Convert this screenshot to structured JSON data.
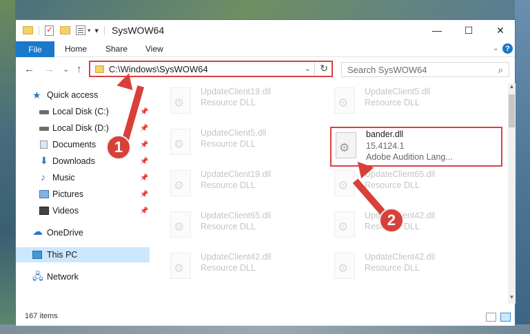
{
  "titlebar": {
    "title": "SysWOW64",
    "minimize": "—",
    "maximize": "☐",
    "close": "✕"
  },
  "ribbon": {
    "tabs": [
      "File",
      "Home",
      "Share",
      "View"
    ],
    "expand_glyph": "⌄",
    "help_glyph": "?"
  },
  "address": {
    "back": "←",
    "forward": "→",
    "recent": "⌄",
    "up": "↑",
    "path": "C:\\Windows\\SysWOW64",
    "dropdown": "⌄",
    "refresh": "↻"
  },
  "search": {
    "placeholder": "Search SysWOW64",
    "icon": "⌕"
  },
  "nav": {
    "items": [
      {
        "label": "Quick access",
        "icon": "star-icon",
        "pinned": false
      },
      {
        "label": "Local Disk (C:)",
        "icon": "drive-icon",
        "pinned": true
      },
      {
        "label": "Local Disk (D:)",
        "icon": "drive-icon",
        "pinned": true
      },
      {
        "label": "Documents",
        "icon": "documents-icon",
        "pinned": true
      },
      {
        "label": "Downloads",
        "icon": "downloads-icon",
        "pinned": true
      },
      {
        "label": "Music",
        "icon": "music-icon",
        "pinned": true
      },
      {
        "label": "Pictures",
        "icon": "pictures-icon",
        "pinned": true
      },
      {
        "label": "Videos",
        "icon": "videos-icon",
        "pinned": true
      },
      {
        "label": "OneDrive",
        "icon": "cloud-icon",
        "pinned": false
      },
      {
        "label": "This PC",
        "icon": "pc-icon",
        "pinned": false,
        "selected": true
      },
      {
        "label": "Network",
        "icon": "network-icon",
        "pinned": false
      }
    ],
    "pin_glyph": "📌"
  },
  "files": [
    {
      "name": "UpdateClient19.dll",
      "type": "Resource DLL",
      "faded": true
    },
    {
      "name": "UpdateClient5.dll",
      "type": "Resource DLL",
      "faded": true
    },
    {
      "name": "UpdateClient5.dll",
      "type": "Resource DLL",
      "faded": true
    },
    {
      "name": "bander.dll",
      "version": "15.4124.1",
      "description": "Adobe Audition Lang...",
      "faded": false,
      "highlighted": true
    },
    {
      "name": "UpdateClient19.dll",
      "type": "Resource DLL",
      "faded": true
    },
    {
      "name": "UpdateClient65.dll",
      "type": "Resource DLL",
      "faded": true
    },
    {
      "name": "UpdateClient65.dll",
      "type": "Resource DLL",
      "faded": true
    },
    {
      "name": "UpdateClient42.dll",
      "type": "Resource DLL",
      "faded": true
    },
    {
      "name": "UpdateClient42.dll",
      "type": "Resource DLL",
      "faded": true
    },
    {
      "name": "UpdateClient42.dll",
      "type": "Resource DLL",
      "faded": true
    }
  ],
  "status": {
    "item_count": "167 items"
  },
  "markers": {
    "one": "1",
    "two": "2"
  },
  "colors": {
    "accent": "#1979ca",
    "highlight": "#d9403a",
    "selected_bg": "#cce8ff"
  }
}
